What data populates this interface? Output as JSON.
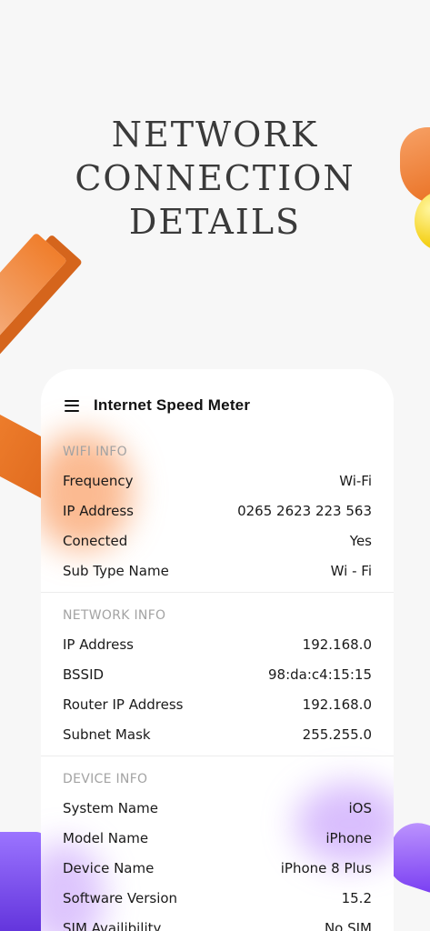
{
  "headline": {
    "line1": "NETWORK",
    "line2": "CONNECTION",
    "line3": "DETAILS"
  },
  "app": {
    "title": "Internet Speed Meter",
    "menu_icon": "hamburger-menu-icon"
  },
  "sections": {
    "wifi": {
      "title": "WIFI INFO",
      "rows": [
        {
          "label": "Frequency",
          "value": "Wi-Fi"
        },
        {
          "label": "IP Address",
          "value": "0265 2623 223 563"
        },
        {
          "label": "Conected",
          "value": "Yes"
        },
        {
          "label": "Sub Type Name",
          "value": "Wi - Fi"
        }
      ]
    },
    "network": {
      "title": "NETWORK INFO",
      "rows": [
        {
          "label": "IP Address",
          "value": "192.168.0"
        },
        {
          "label": "BSSID",
          "value": "98:da:c4:15:15"
        },
        {
          "label": "Router IP Address",
          "value": "192.168.0"
        },
        {
          "label": "Subnet Mask",
          "value": "255.255.0"
        }
      ]
    },
    "device": {
      "title": "DEVICE INFO",
      "rows": [
        {
          "label": "System Name",
          "value": "iOS"
        },
        {
          "label": "Model Name",
          "value": "iPhone"
        },
        {
          "label": "Device Name",
          "value": "iPhone 8 Plus"
        },
        {
          "label": "Software Version",
          "value": "15.2"
        },
        {
          "label": "SIM Availibility",
          "value": "No SIM"
        }
      ]
    }
  },
  "colors": {
    "background": "#f7f7f7",
    "card": "#ffffff",
    "accent_orange": "#f07e2c",
    "accent_purple": "#7a3ff2",
    "accent_yellow": "#f5d21d"
  }
}
